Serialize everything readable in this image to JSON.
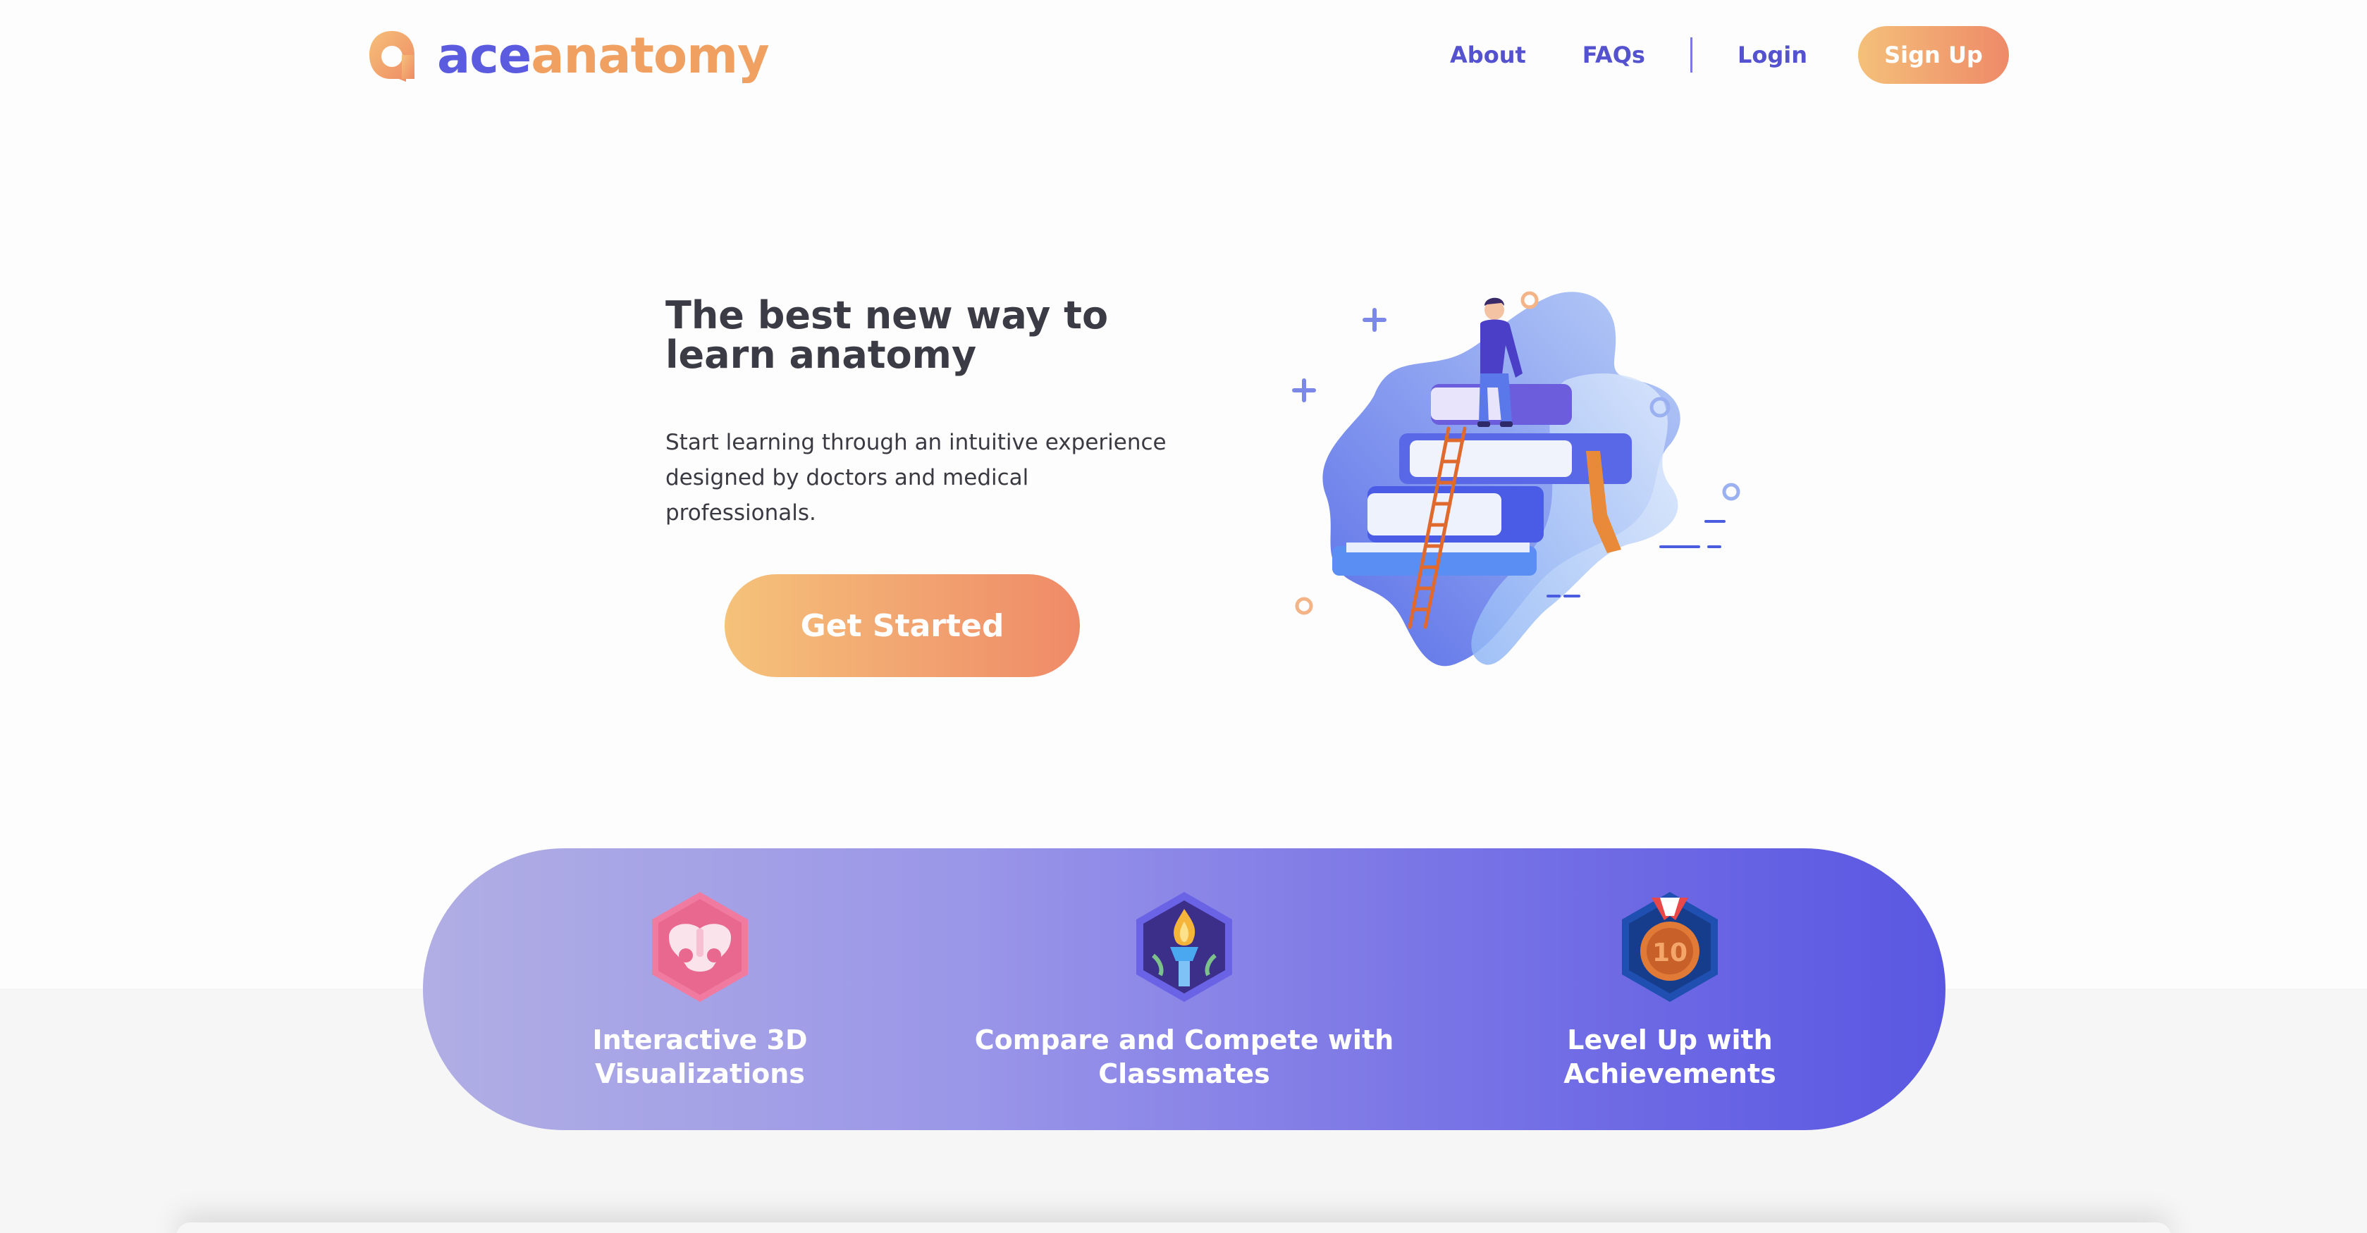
{
  "brand": {
    "name_part1": "ace",
    "name_part2": "anatomy",
    "logo_icon": "aceanatomy-logo-icon",
    "color_primary": "#5b5be0",
    "color_accent": "#f0a060"
  },
  "nav": {
    "about": "About",
    "faqs": "FAQs",
    "login": "Login",
    "signup": "Sign Up"
  },
  "hero": {
    "title": "The best new way to learn anatomy",
    "description": "Start learning through an intuitive experience designed by doctors and medical professionals.",
    "cta": "Get Started",
    "illustration": "person-sitting-on-book-stack-illustration"
  },
  "features": [
    {
      "label": "Interactive 3D Visualizations",
      "icon": "pelvis-bone-badge-icon"
    },
    {
      "label": "Compare and Compete with Classmates",
      "icon": "torch-badge-icon"
    },
    {
      "label": "Level Up with Achievements",
      "icon": "medal-10-badge-icon"
    }
  ]
}
